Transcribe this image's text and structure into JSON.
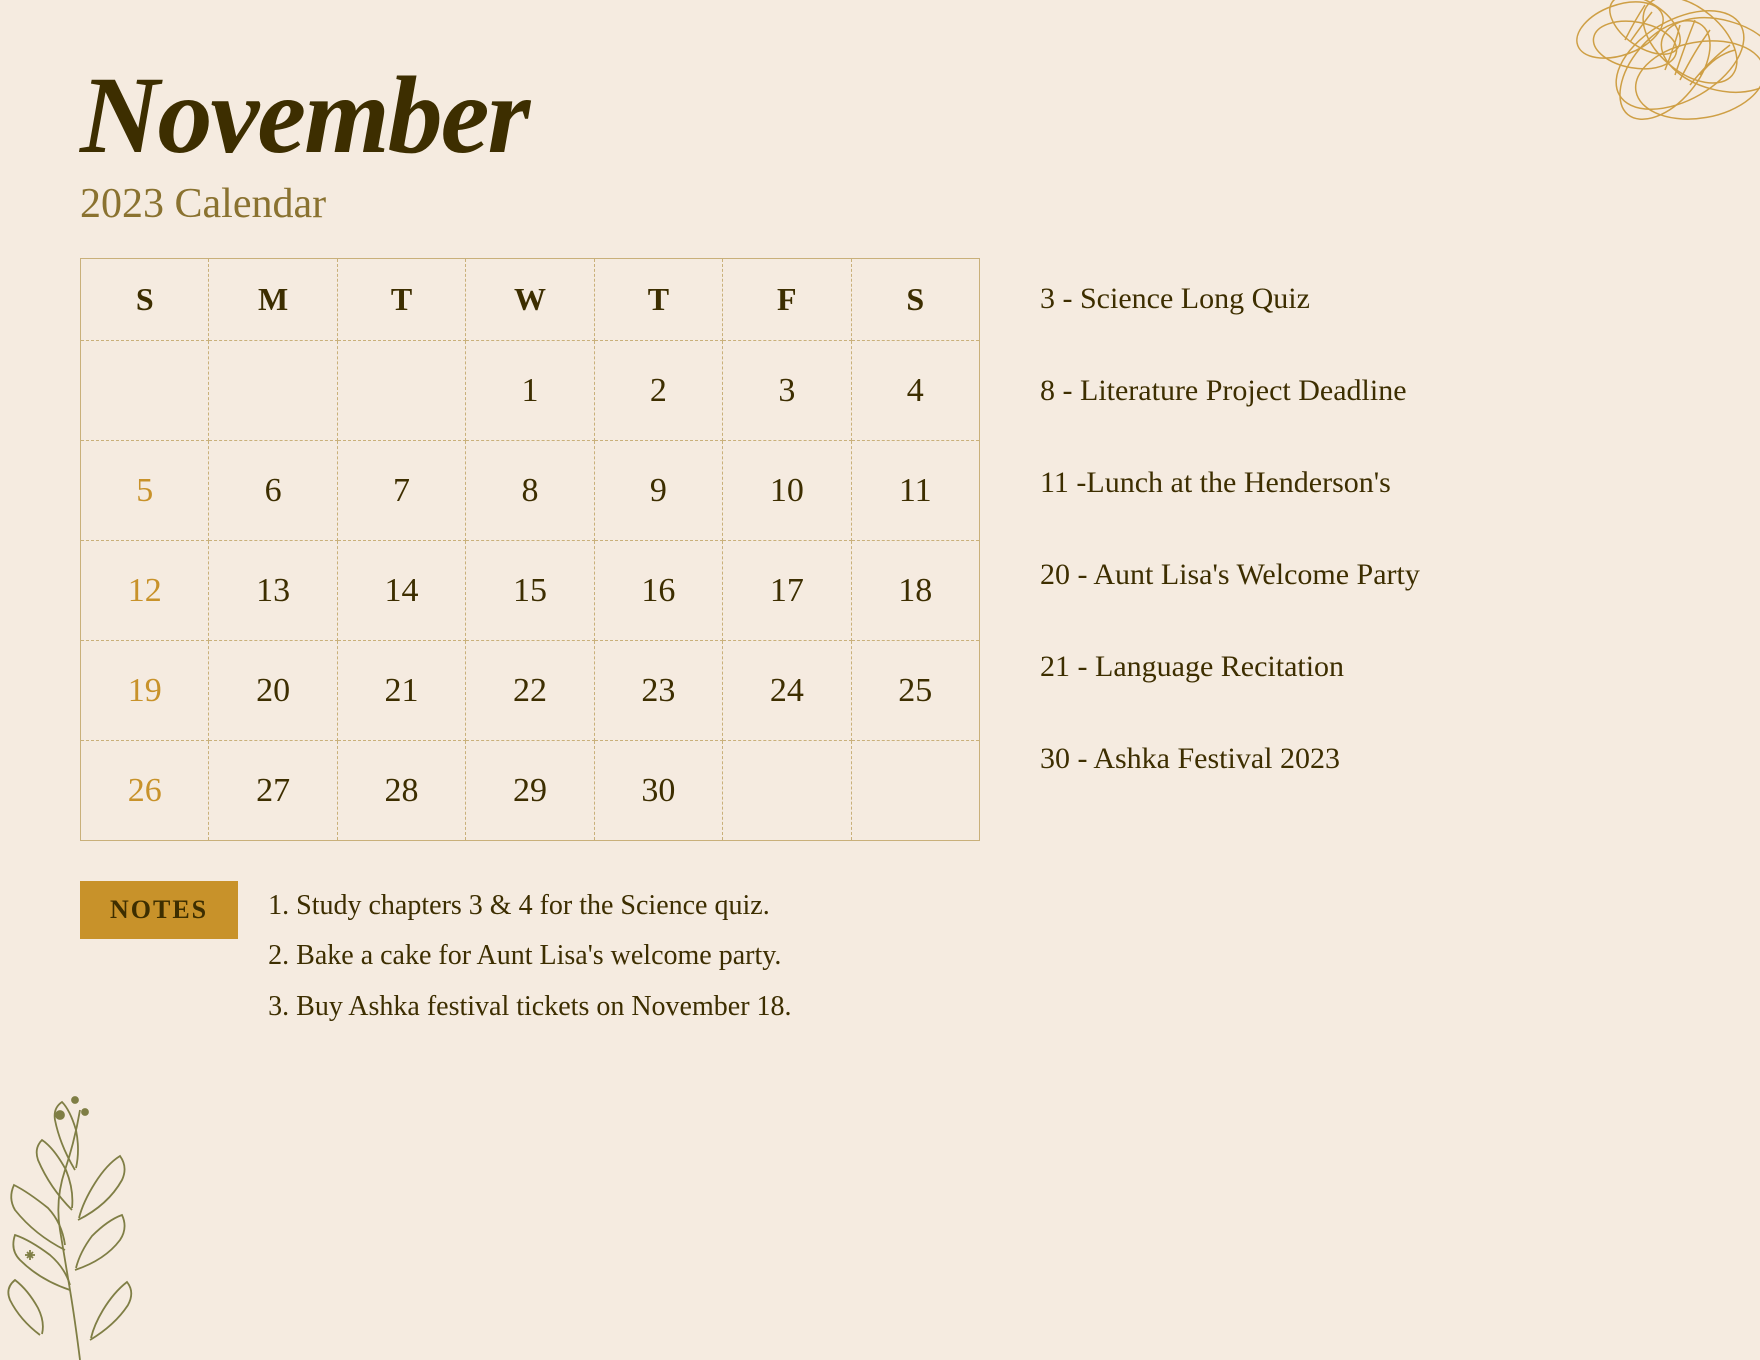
{
  "header": {
    "month": "November",
    "year_calendar": "2023 Calendar"
  },
  "calendar": {
    "days_of_week": [
      "S",
      "M",
      "T",
      "W",
      "T",
      "F",
      "S"
    ],
    "weeks": [
      [
        "",
        "",
        "",
        "1",
        "2",
        "3",
        "4"
      ],
      [
        "5",
        "6",
        "7",
        "8",
        "9",
        "10",
        "11"
      ],
      [
        "12",
        "13",
        "14",
        "15",
        "16",
        "17",
        "18"
      ],
      [
        "19",
        "20",
        "21",
        "22",
        "23",
        "24",
        "25"
      ],
      [
        "26",
        "27",
        "28",
        "29",
        "30",
        "",
        ""
      ]
    ]
  },
  "events": [
    "3 - Science Long Quiz",
    "8 - Literature Project Deadline",
    "11 -Lunch at the Henderson's",
    "20 - Aunt Lisa's Welcome Party",
    "21 - Language Recitation",
    "30 - Ashka Festival 2023"
  ],
  "notes": {
    "label": "NOTES",
    "items": [
      "1. Study chapters 3 & 4 for the Science quiz.",
      "2. Bake a cake for Aunt Lisa's welcome party.",
      "3. Buy Ashka festival tickets on November 18."
    ]
  }
}
